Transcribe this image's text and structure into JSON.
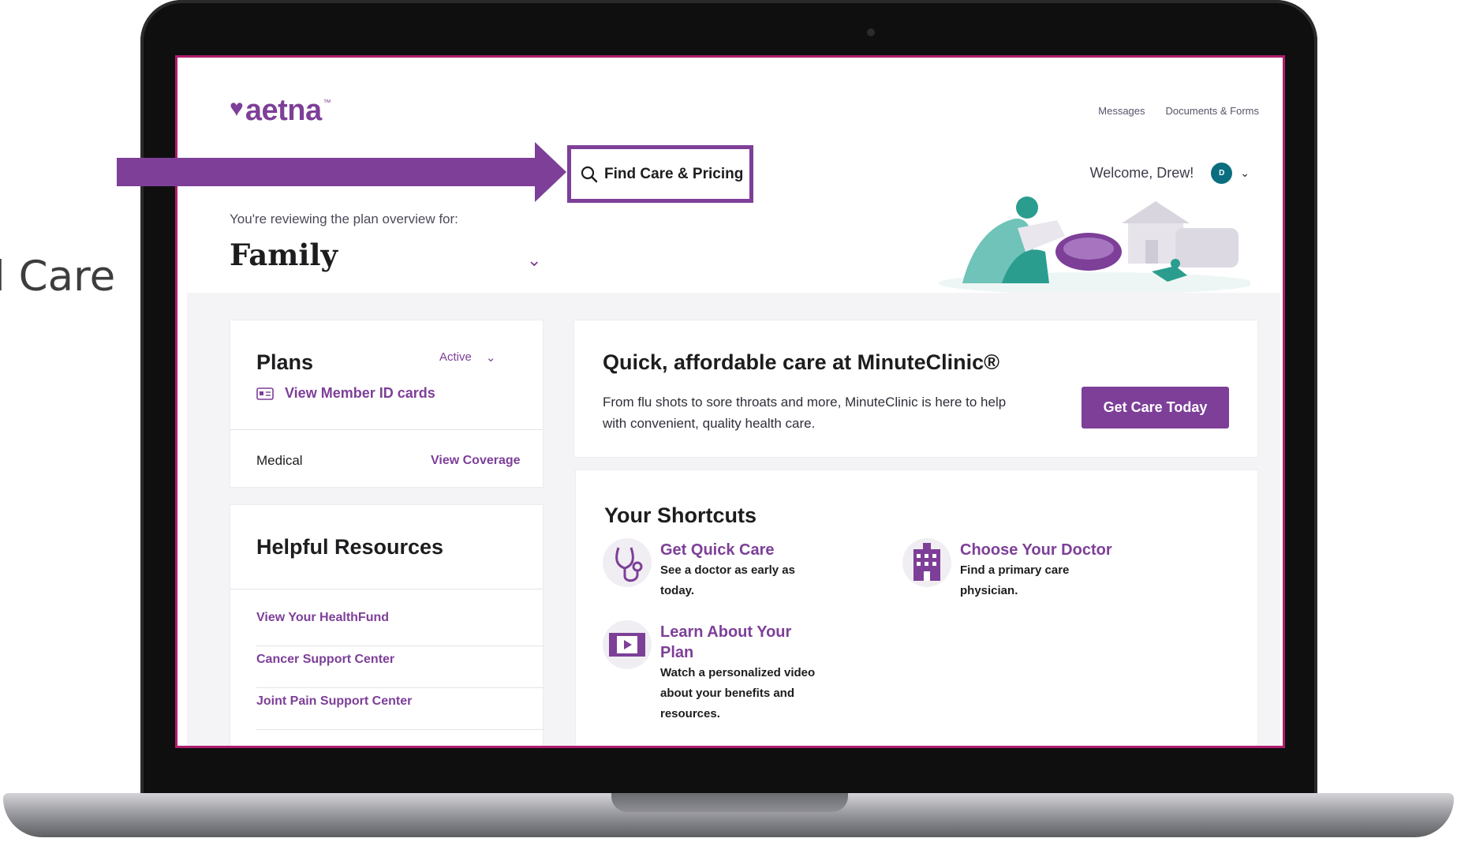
{
  "side_caption": "l Care",
  "header": {
    "logo_text": "aetna",
    "logo_tm": "™",
    "links": [
      "Messages",
      "Documents & Forms"
    ],
    "find_care": "Find Care & Pricing",
    "welcome": "Welcome, Drew!",
    "avatar_initial": "D"
  },
  "hero": {
    "reviewing": "You're reviewing the plan overview for:",
    "plan_name": "Family"
  },
  "plans": {
    "title": "Plans",
    "status": "Active",
    "member_link": "View Member ID cards",
    "row_label": "Medical",
    "row_link": "View Coverage"
  },
  "resources": {
    "title": "Helpful Resources",
    "items": [
      "View Your HealthFund",
      "Cancer Support Center",
      "Joint Pain Support Center"
    ]
  },
  "minuteclinic": {
    "title": "Quick, affordable care at MinuteClinic®",
    "text": "From flu shots to sore throats and more, MinuteClinic is here to help with convenient, quality health care.",
    "button": "Get Care Today"
  },
  "shortcuts": {
    "title": "Your Shortcuts",
    "items": [
      {
        "title": "Get Quick Care",
        "desc": "See a doctor as early as today.",
        "icon": "stethoscope-icon"
      },
      {
        "title": "Choose Your Doctor",
        "desc": "Find a primary care physician.",
        "icon": "hospital-icon"
      },
      {
        "title": "Learn About Your Plan",
        "desc": "Watch a personalized video about your benefits and resources.",
        "icon": "video-icon"
      }
    ]
  },
  "colors": {
    "brand_purple": "#7d3f98",
    "screen_border": "#b01e6e",
    "avatar_teal": "#0b6e7f"
  }
}
